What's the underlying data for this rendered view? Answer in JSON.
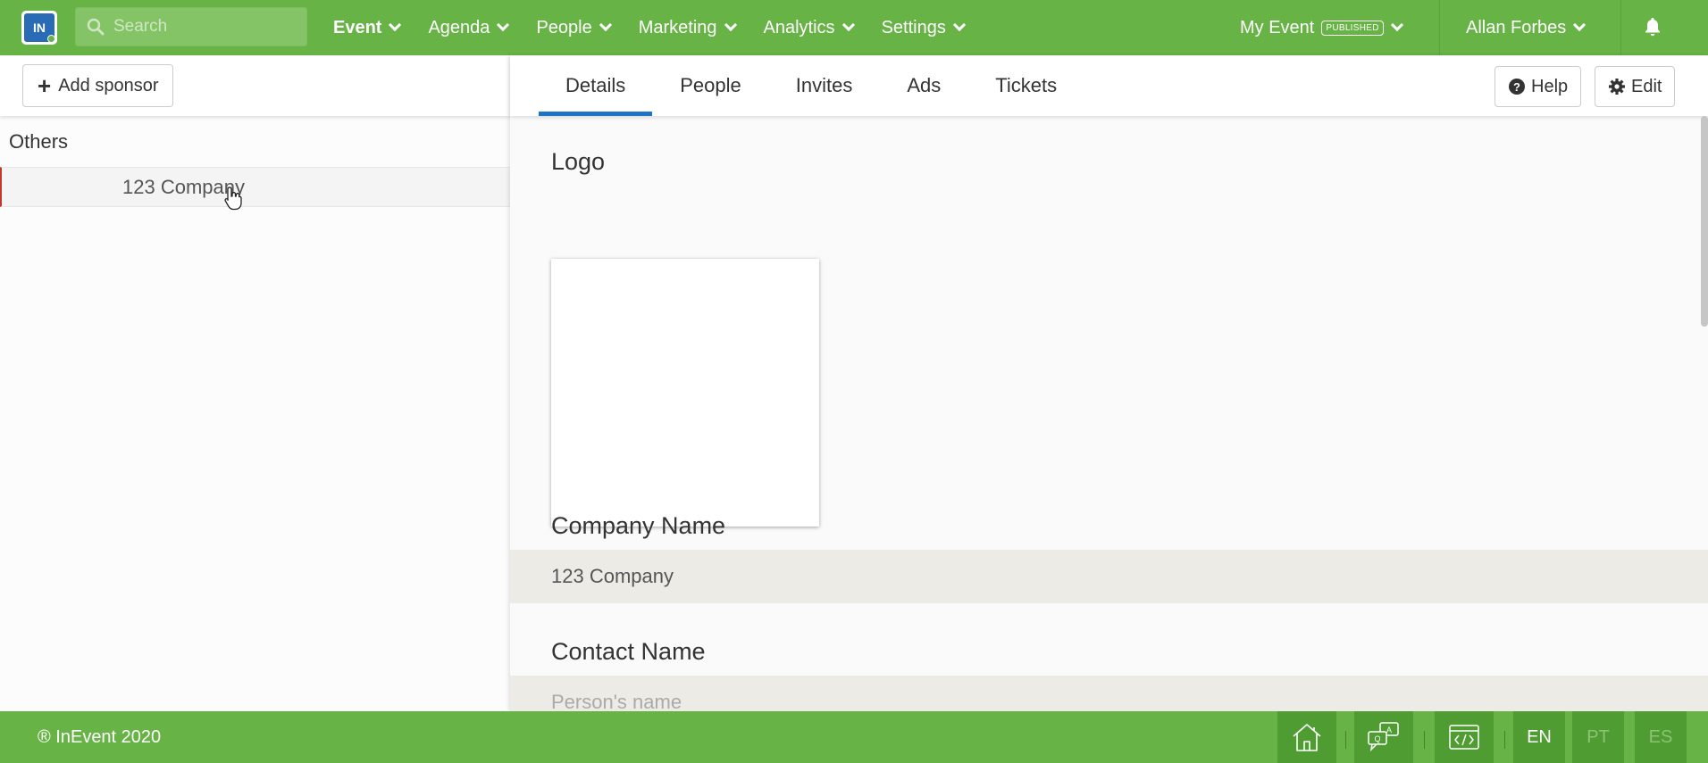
{
  "topbar": {
    "logo_text": "IN",
    "search_placeholder": "Search",
    "nav": [
      {
        "label": "Event"
      },
      {
        "label": "Agenda"
      },
      {
        "label": "People"
      },
      {
        "label": "Marketing"
      },
      {
        "label": "Analytics"
      },
      {
        "label": "Settings"
      }
    ],
    "event_name": "My Event",
    "event_status": "PUBLISHED",
    "user_name": "Allan Forbes"
  },
  "left": {
    "add_button": "Add sponsor",
    "group_title": "Others",
    "sponsors": [
      {
        "name": "123 Company",
        "selected": true
      }
    ]
  },
  "right": {
    "tabs": [
      {
        "label": "Details",
        "active": true
      },
      {
        "label": "People",
        "active": false
      },
      {
        "label": "Invites",
        "active": false
      },
      {
        "label": "Ads",
        "active": false
      },
      {
        "label": "Tickets",
        "active": false
      }
    ],
    "help_button": "Help",
    "edit_button": "Edit",
    "fields": {
      "logo_label": "Logo",
      "company_name_label": "Company Name",
      "company_name_value": "123 Company",
      "contact_name_label": "Contact Name",
      "contact_name_placeholder": "Person's name"
    }
  },
  "footer": {
    "copyright": "® InEvent 2020",
    "languages": [
      "EN",
      "PT",
      "ES"
    ],
    "active_language": "EN"
  },
  "colors": {
    "brand_green": "#67b346",
    "dark_green": "#4e9c32",
    "tab_accent": "#1e74c7",
    "selection_marker": "#c0392b"
  }
}
